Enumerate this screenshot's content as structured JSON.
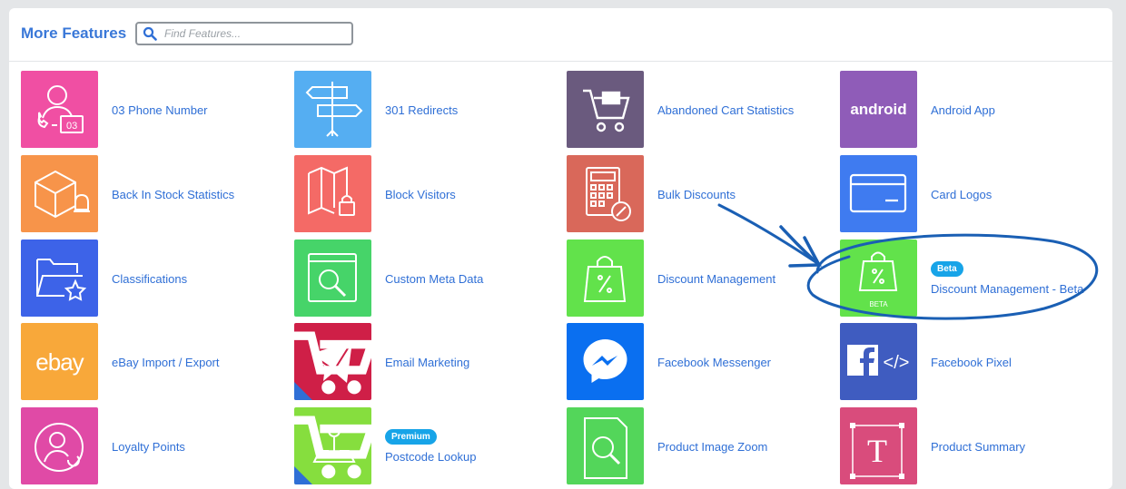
{
  "header": {
    "title": "More Features",
    "search_placeholder": "Find Features..."
  },
  "features": [
    {
      "label": "03 Phone Number",
      "color": "#f04fa3",
      "icon": "phone-number-icon",
      "tile_text": "03"
    },
    {
      "label": "301 Redirects",
      "color": "#55aef2",
      "icon": "signpost-icon"
    },
    {
      "label": "Abandoned Cart Statistics",
      "color": "#6a5a7e",
      "icon": "shopping-cart-icon"
    },
    {
      "label": "Android App",
      "color": "#8f5cb8",
      "icon": "android-logo-icon",
      "tile_text": "android"
    },
    {
      "label": "Back In Stock Statistics",
      "color": "#f7944a",
      "icon": "box-bell-icon"
    },
    {
      "label": "Block Visitors",
      "color": "#f46a66",
      "icon": "map-lock-icon"
    },
    {
      "label": "Bulk Discounts",
      "color": "#d9685a",
      "icon": "calculator-percent-icon"
    },
    {
      "label": "Card Logos",
      "color": "#3f7bf0",
      "icon": "credit-card-icon"
    },
    {
      "label": "Classifications",
      "color": "#3d63e8",
      "icon": "folder-star-icon"
    },
    {
      "label": "Custom Meta Data",
      "color": "#46d469",
      "icon": "search-window-icon"
    },
    {
      "label": "Discount Management",
      "color": "#62e24b",
      "icon": "discount-bag-icon"
    },
    {
      "label": "Discount Management - Beta",
      "color": "#62e24b",
      "icon": "discount-bag-beta-icon",
      "badge": "Beta",
      "tile_text": "BETA"
    },
    {
      "label": "eBay Import / Export",
      "color": "#f8a83a",
      "icon": "ebay-logo-icon",
      "tile_text": "ebay"
    },
    {
      "label": "Email Marketing",
      "color": "#cf1f47",
      "icon": "envelope-icon"
    },
    {
      "label": "Facebook Messenger",
      "color": "#0a6ff0",
      "icon": "messenger-icon"
    },
    {
      "label": "Facebook Pixel",
      "color": "#3f5cc0",
      "icon": "facebook-pixel-icon",
      "tile_text": "</>"
    },
    {
      "label": "Loyalty Points",
      "color": "#e04aa6",
      "icon": "loyalty-user-icon"
    },
    {
      "label": "Postcode Lookup",
      "color": "#86de3e",
      "icon": "map-pin-icon",
      "badge": "Premium"
    },
    {
      "label": "Product Image Zoom",
      "color": "#53d65a",
      "icon": "image-zoom-icon"
    },
    {
      "label": "Product Summary",
      "color": "#d94c7c",
      "icon": "text-frame-icon",
      "tile_text": "T"
    }
  ]
}
